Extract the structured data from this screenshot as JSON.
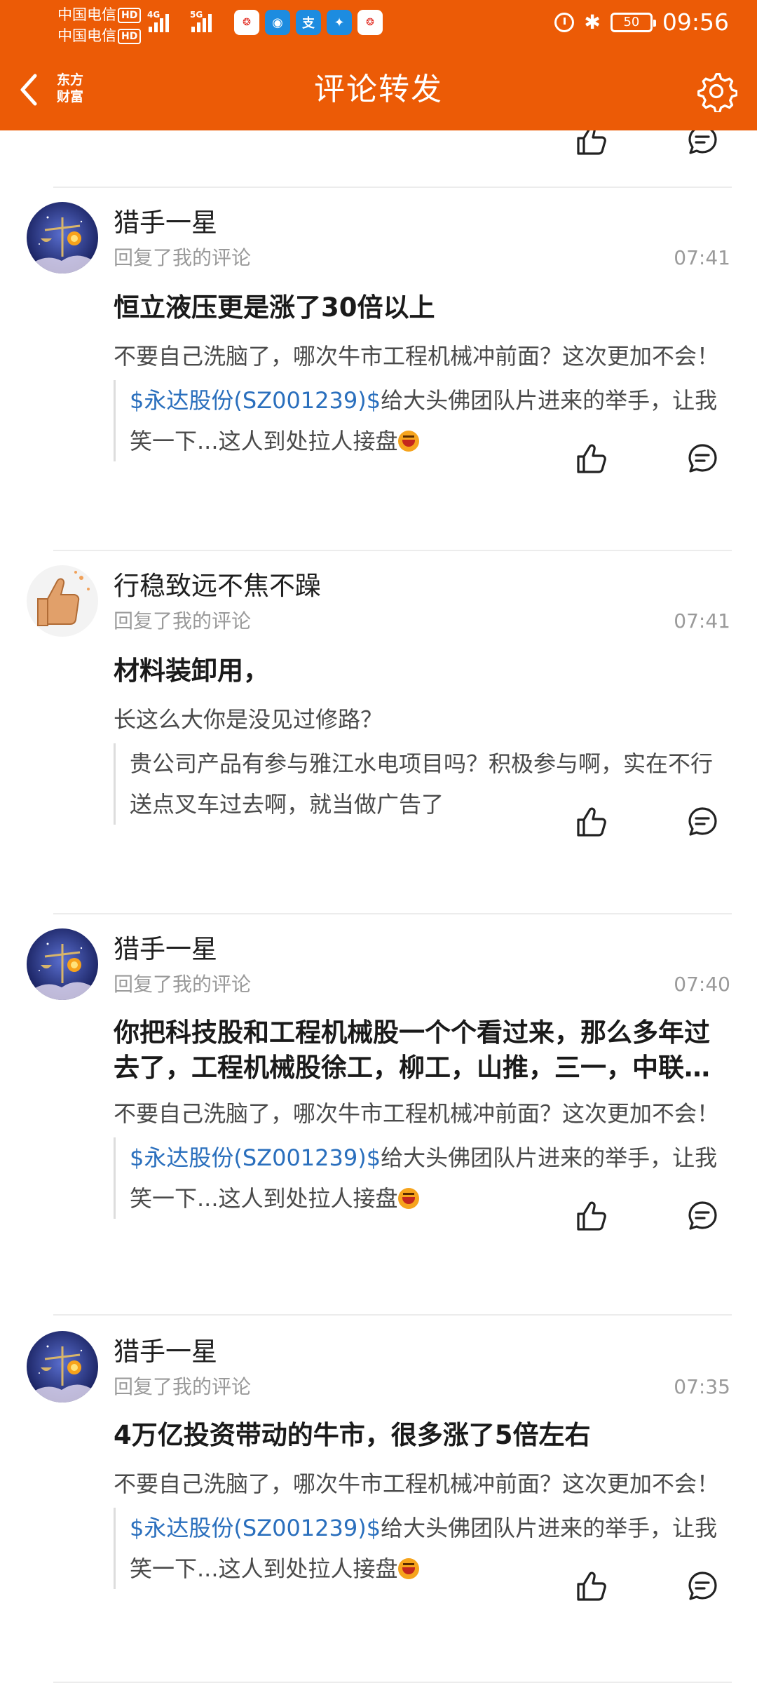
{
  "status_bar": {
    "carrier_1": "中国电信",
    "carrier_2": "中国电信",
    "hd_badge": "HD",
    "net_1": "4G",
    "net_2": "5G",
    "battery": "50",
    "time": "09:56"
  },
  "header": {
    "title": "评论转发",
    "logo_line1": "东方",
    "logo_line2": "财富"
  },
  "colors": {
    "header_bg": "#ec5b06",
    "stock_link": "#2a6fbd",
    "meta_gray": "#9a9a9a"
  },
  "icons": {
    "back": "chevron-left-icon",
    "settings": "gear-icon",
    "like": "thumbs-up-icon",
    "comment": "comment-bubble-icon"
  },
  "feed": {
    "items": [
      {
        "user": "猎手一星",
        "action": "回复了我的评论",
        "time": "07:41",
        "reply": "恒立液压更是涨了30倍以上",
        "mine": "不要自己洗脑了，哪次牛市工程机械冲前面？这次更加不会！",
        "quote_stock": "$永达股份(SZ001239)$",
        "quote_text": "给大头佛团队片进来的举手，让我笑一下...这人到处拉人接盘"
      },
      {
        "user": "行稳致远不焦不躁",
        "action": "回复了我的评论",
        "time": "07:41",
        "reply": "材料装卸用，",
        "mine": "长这么大你是没见过修路？",
        "quote_stock": "",
        "quote_text": "贵公司产品有参与雅江水电项目吗？积极参与啊，实在不行送点叉车过去啊，就当做广告了"
      },
      {
        "user": "猎手一星",
        "action": "回复了我的评论",
        "time": "07:40",
        "reply": "你把科技股和工程机械股一个个看过来，那么多年过去了，工程机械股徐工，柳工，山推，三一，中联，恒立都涨了很多倍",
        "mine": "不要自己洗脑了，哪次牛市工程机械冲前面？这次更加不会！",
        "quote_stock": "$永达股份(SZ001239)$",
        "quote_text": "给大头佛团队片进来的举手，让我笑一下...这人到处拉人接盘"
      },
      {
        "user": "猎手一星",
        "action": "回复了我的评论",
        "time": "07:35",
        "reply": "4万亿投资带动的牛市，很多涨了5倍左右",
        "mine": "不要自己洗脑了，哪次牛市工程机械冲前面？这次更加不会！",
        "quote_stock": "$永达股份(SZ001239)$",
        "quote_text": "给大头佛团队片进来的举手，让我笑一下...这人到处拉人接盘"
      }
    ]
  }
}
